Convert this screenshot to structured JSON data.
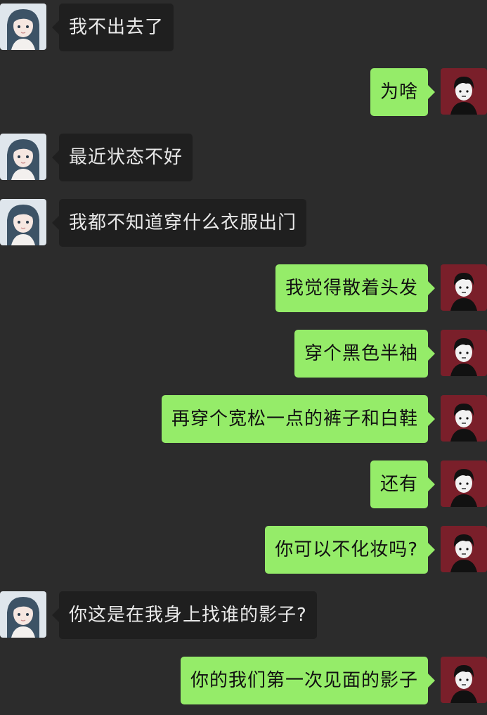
{
  "contacts": {
    "friend_avatar_icon": "anime-girl-avatar",
    "self_avatar_icon": "anime-boy-avatar"
  },
  "colors": {
    "background": "#2c2c2c",
    "received_bubble": "#1f1f1f",
    "sent_bubble": "#95ec69",
    "received_text": "#e9e9e9",
    "sent_text": "#111111"
  },
  "messages": [
    {
      "side": "left",
      "text": "我不出去了"
    },
    {
      "side": "right",
      "text": "为啥"
    },
    {
      "side": "left",
      "text": "最近状态不好"
    },
    {
      "side": "left",
      "text": "我都不知道穿什么衣服出门"
    },
    {
      "side": "right",
      "text": "我觉得散着头发"
    },
    {
      "side": "right",
      "text": "穿个黑色半袖"
    },
    {
      "side": "right",
      "text": "再穿个宽松一点的裤子和白鞋"
    },
    {
      "side": "right",
      "text": "还有"
    },
    {
      "side": "right",
      "text": "你可以不化妆吗?"
    },
    {
      "side": "left",
      "text": "你这是在我身上找谁的影子?"
    },
    {
      "side": "right",
      "text": "你的我们第一次见面的影子"
    }
  ]
}
